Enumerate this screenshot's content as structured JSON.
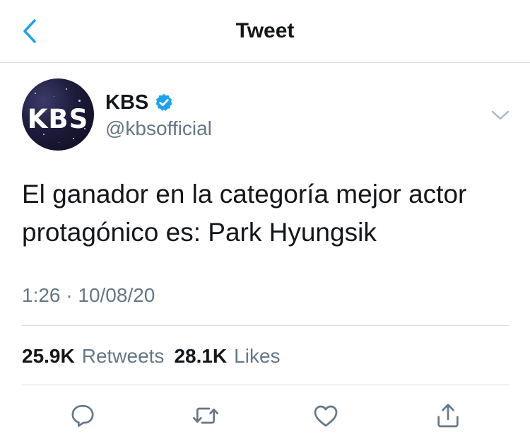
{
  "nav": {
    "title": "Tweet",
    "back_icon": "chevron-left-icon",
    "accent_color": "#1da1f2"
  },
  "tweet": {
    "avatar_logo": "KBS",
    "display_name": "KBS",
    "verified": true,
    "handle": "@kbsofficial",
    "text": "El ganador en la categoría mejor actor protagónico es: Park Hyungsik",
    "timestamp": "1:26 · 10/08/20"
  },
  "stats": {
    "retweets_count": "25.9K",
    "retweets_label": "Retweets",
    "likes_count": "28.1K",
    "likes_label": "Likes"
  },
  "actions": [
    "reply-icon",
    "retweet-icon",
    "like-icon",
    "share-icon"
  ],
  "colors": {
    "text": "#14171a",
    "secondary": "#657786",
    "divider": "#dcdfe2",
    "verified": "#1da1f2"
  }
}
